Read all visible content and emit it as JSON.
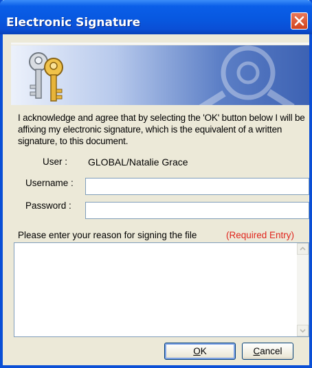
{
  "window": {
    "title": "Electronic Signature"
  },
  "banner": {
    "icon": "keys-icon"
  },
  "acknowledgement": "I acknowledge and agree that by selecting the 'OK' button below I will be affixing my electronic signature, which is the equivalent of a written signature, to this document.",
  "user": {
    "label": "User :",
    "domain": "GLOBAL/",
    "name": "Natalie Grace"
  },
  "form": {
    "username_label": "Username :",
    "username_value": "",
    "password_label": "Password :",
    "password_value": ""
  },
  "reason": {
    "label": "Please enter your reason for signing the file",
    "required_label": "(Required Entry)",
    "value": ""
  },
  "buttons": {
    "ok": "OK",
    "cancel": "Cancel"
  },
  "colors": {
    "titlebar": "#0a5ee8",
    "required": "#e0241c",
    "close": "#d2431c"
  }
}
